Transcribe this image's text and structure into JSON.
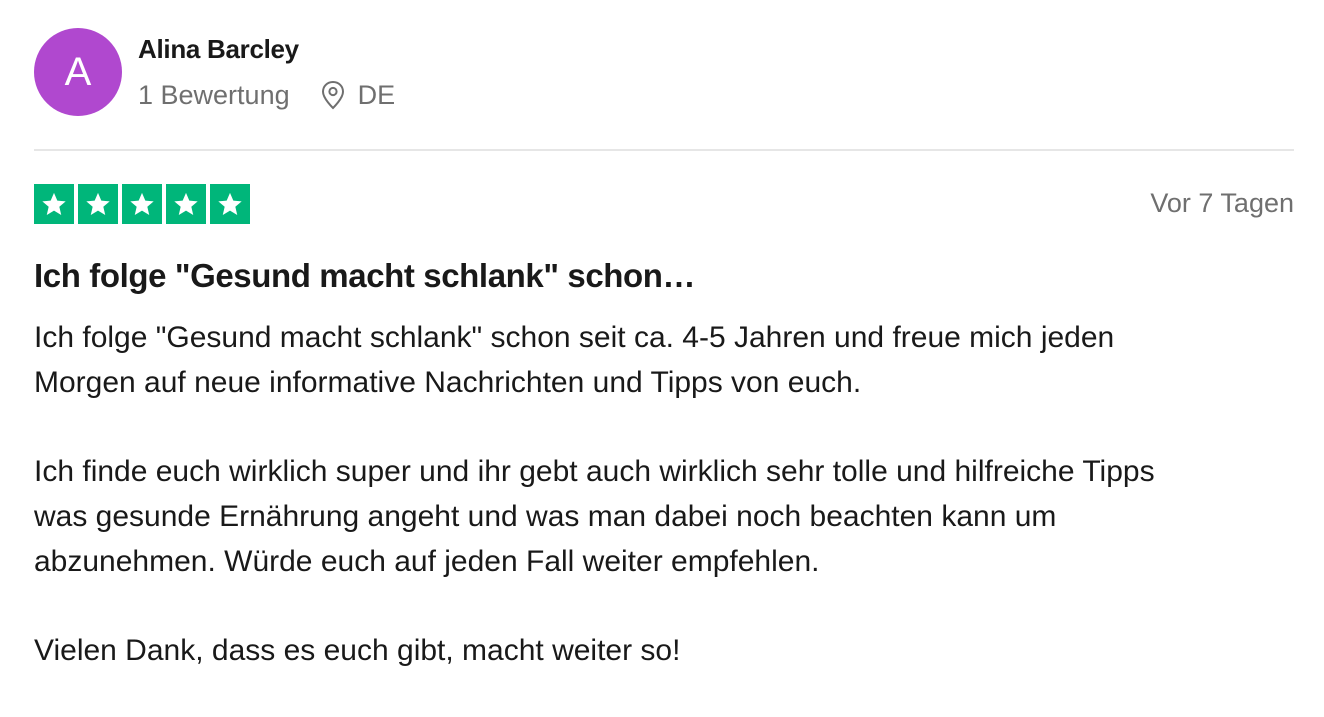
{
  "reviewer": {
    "avatar_letter": "A",
    "avatar_color": "#b048cf",
    "name": "Alina Barcley",
    "review_count": "1 Bewertung",
    "location_icon": "map-pin-icon",
    "country": "DE"
  },
  "review": {
    "rating": 5,
    "rating_max": 5,
    "star_color": "#00b67a",
    "date": "Vor 7 Tagen",
    "title": "Ich folge \"Gesund macht schlank\" schon…",
    "paragraphs": [
      "Ich folge \"Gesund macht schlank\" schon seit ca. 4-5 Jahren und freue mich jeden\nMorgen auf neue informative Nachrichten und Tipps von euch.",
      "Ich finde euch wirklich super und ihr gebt auch wirklich sehr tolle und hilfreiche Tipps\nwas gesunde Ernährung angeht und was man dabei noch beachten kann um\nabzunehmen. Würde euch auf jeden Fall weiter empfehlen.",
      "Vielen Dank, dass es euch gibt, macht weiter so!"
    ]
  }
}
